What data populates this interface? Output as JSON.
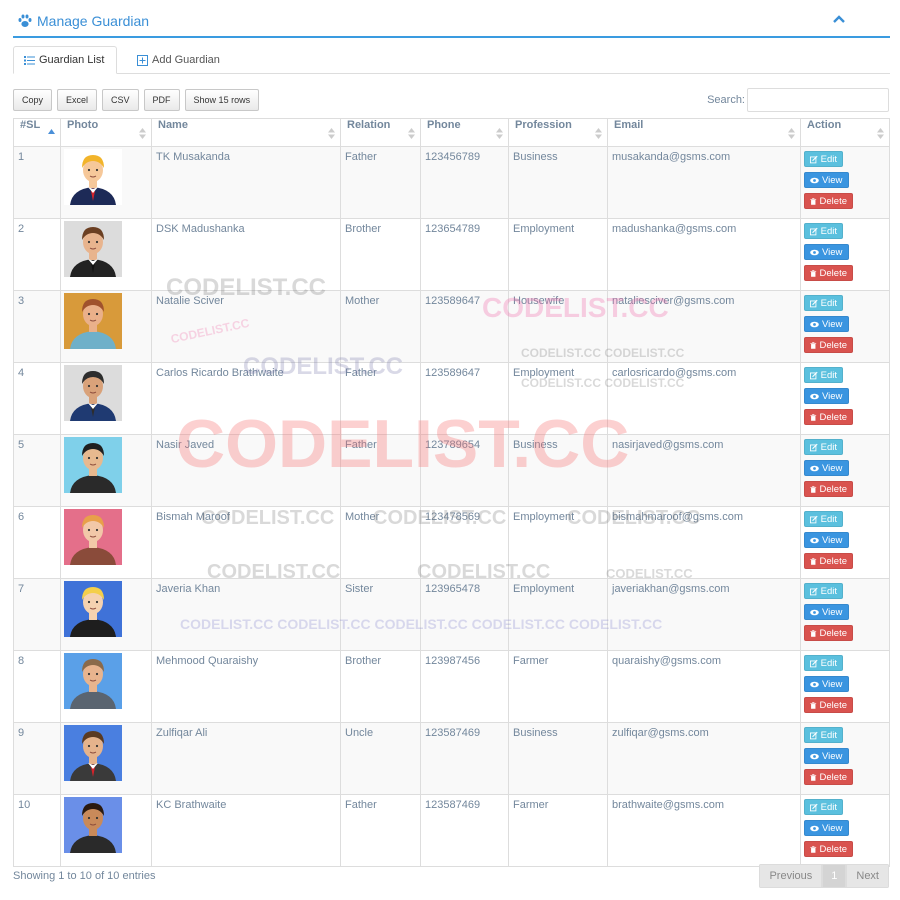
{
  "header": {
    "title": "Manage Guardian",
    "icon": "paw-icon",
    "collapse_icon": "chevron-up-icon"
  },
  "tabs": [
    {
      "label": "Guardian List",
      "icon": "list-icon",
      "active": true
    },
    {
      "label": "Add Guardian",
      "icon": "plus-square-icon",
      "active": false
    }
  ],
  "toolbar": {
    "copy": "Copy",
    "excel": "Excel",
    "csv": "CSV",
    "pdf": "PDF",
    "show_rows": "Show 15 rows"
  },
  "search": {
    "label": "Search:",
    "value": "",
    "placeholder": ""
  },
  "table": {
    "columns": [
      "#SL",
      "Photo",
      "Name",
      "Relation",
      "Phone",
      "Profession",
      "Email",
      "Action"
    ],
    "sorted_column": "#SL",
    "rows": [
      {
        "sl": "1",
        "name": "TK Musakanda",
        "relation": "Father",
        "phone": "123456789",
        "profession": "Business",
        "email": "musakanda@gsms.com",
        "avatar": {
          "skin": "#f6c89a",
          "hair": "#f2b42a",
          "shirt": "#1d2a57",
          "tie": "#d6232b",
          "bg": "#ffffff"
        }
      },
      {
        "sl": "2",
        "name": "DSK Madushanka",
        "relation": "Brother",
        "phone": "123654789",
        "profession": "Employment",
        "email": "madushanka@gsms.com",
        "avatar": {
          "skin": "#e8b48e",
          "hair": "#6b3f22",
          "shirt": "#222222",
          "tie": "#111111",
          "bg": "#dcdcdc"
        }
      },
      {
        "sl": "3",
        "name": "Natalie Sciver",
        "relation": "Mother",
        "phone": "123589647",
        "profession": "Housewife",
        "email": "nataliesciver@gsms.com",
        "avatar": {
          "skin": "#eab08a",
          "hair": "#a0522d",
          "shirt": "#6fb0c9",
          "tie": "",
          "bg": "#d89a3a"
        }
      },
      {
        "sl": "4",
        "name": "Carlos Ricardo Brathwaite",
        "relation": "Father",
        "phone": "123589647",
        "profession": "Employment",
        "email": "carlosricardo@gsms.com",
        "avatar": {
          "skin": "#d9a27a",
          "hair": "#2d2d2d",
          "shirt": "#1f3a72",
          "tie": "#2d2d2d",
          "bg": "#dcdcdc"
        }
      },
      {
        "sl": "5",
        "name": "Nasir Javed",
        "relation": "Father",
        "phone": "123789654",
        "profession": "Business",
        "email": "nasirjaved@gsms.com",
        "avatar": {
          "skin": "#e7b98f",
          "hair": "#1f1f1f",
          "shirt": "#2a2a2a",
          "tie": "",
          "bg": "#7fd0ea"
        }
      },
      {
        "sl": "6",
        "name": "Bismah Maroof",
        "relation": "Mother",
        "phone": "123478569",
        "profession": "Employment",
        "email": "bismahmaroof@gsms.com",
        "avatar": {
          "skin": "#f2c8a8",
          "hair": "#e8a04a",
          "shirt": "#8a4b3a",
          "tie": "",
          "bg": "#e46f8a"
        }
      },
      {
        "sl": "7",
        "name": "Javeria Khan",
        "relation": "Sister",
        "phone": "123965478",
        "profession": "Employment",
        "email": "javeriakhan@gsms.com",
        "avatar": {
          "skin": "#f5d2b0",
          "hair": "#f4cf4a",
          "shirt": "#1e1e1e",
          "tie": "",
          "bg": "#3f72d8"
        }
      },
      {
        "sl": "8",
        "name": "Mehmood Quaraishy",
        "relation": "Brother",
        "phone": "123987456",
        "profession": "Farmer",
        "email": "quaraishy@gsms.com",
        "avatar": {
          "skin": "#e8b48e",
          "hair": "#8a6a4a",
          "shirt": "#5a6470",
          "tie": "",
          "bg": "#5aa0e8"
        }
      },
      {
        "sl": "9",
        "name": "Zulfiqar Ali",
        "relation": "Uncle",
        "phone": "123587469",
        "profession": "Business",
        "email": "zulfiqar@gsms.com",
        "avatar": {
          "skin": "#e5b38c",
          "hair": "#5a3a22",
          "shirt": "#3a3a3a",
          "tie": "#d6232b",
          "bg": "#4a7fe0"
        }
      },
      {
        "sl": "10",
        "name": "KC Brathwaite",
        "relation": "Father",
        "phone": "123587469",
        "profession": "Farmer",
        "email": "brathwaite@gsms.com",
        "avatar": {
          "skin": "#c98a5a",
          "hair": "#2a1a10",
          "shirt": "#2a2a2a",
          "tie": "",
          "bg": "#6a8fe8"
        }
      }
    ],
    "actions": {
      "edit": "Edit",
      "view": "View",
      "delete": "Delete"
    }
  },
  "footer": {
    "info": "Showing 1 to 10 of 10 entries",
    "previous": "Previous",
    "page": "1",
    "next": "Next"
  },
  "watermarks": [
    "CODELIST.CC",
    "CODELIST.CC",
    "CODELIST.CC",
    "CODELIST.CC",
    "CODELIST.CC CODELIST.CC",
    "CODELIST.CC CODELIST.CC",
    "CODELIST.CC",
    "CODELIST.CC",
    "CODELIST.CC",
    "CODELIST.CC",
    "CODELIST.CC",
    "CODELIST.CC",
    "CODELIST.CC",
    "CODELIST.CC  CODELIST.CC  CODELIST.CC  CODELIST.CC  CODELIST.CC"
  ],
  "colors": {
    "accent": "#3a9be0",
    "edit": "#5bc0de",
    "view": "#3a95e0",
    "delete": "#d9534f"
  }
}
